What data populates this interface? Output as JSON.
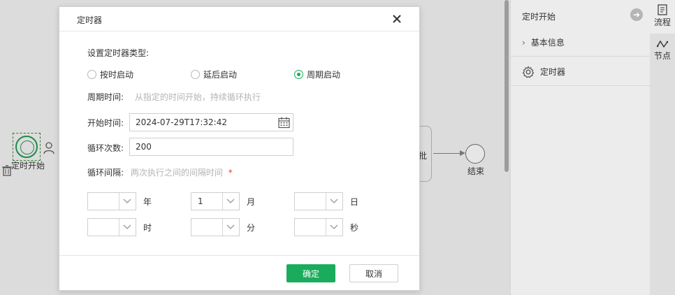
{
  "canvas": {
    "start_label": "定时开始",
    "task_text": "批",
    "end_label": "结束"
  },
  "panel": {
    "title": "定时开始",
    "rows": [
      {
        "label": "基本信息",
        "icon": "chevron-right-icon"
      },
      {
        "label": "定时器",
        "icon": "gear-icon"
      }
    ]
  },
  "side_tabs": [
    {
      "label": "流程",
      "icon": "flow-icon"
    },
    {
      "label": "节点",
      "icon": "node-icon"
    }
  ],
  "modal": {
    "title": "定时器",
    "type_label": "设置定时器类型:",
    "types": [
      {
        "label": "按时启动",
        "checked": false
      },
      {
        "label": "延后启动",
        "checked": false
      },
      {
        "label": "周期启动",
        "checked": true
      }
    ],
    "period_label": "周期时间:",
    "period_hint": "从指定的时间开始，持续循环执行",
    "start_time_label": "开始时间:",
    "start_time_value": "2024-07-29T17:32:42",
    "loop_count_label": "循环次数:",
    "loop_count_value": "200",
    "interval_label": "循环间隔:",
    "interval_hint": "两次执行之间的间隔时间",
    "required_mark": "*",
    "interval_fields": [
      {
        "value": "",
        "unit": "年"
      },
      {
        "value": "1",
        "unit": "月"
      },
      {
        "value": "",
        "unit": "日"
      },
      {
        "value": "",
        "unit": "时"
      },
      {
        "value": "",
        "unit": "分"
      },
      {
        "value": "",
        "unit": "秒"
      }
    ],
    "ok_label": "确定",
    "cancel_label": "取消"
  },
  "colors": {
    "accent": "#1aac5c",
    "required": "#e0403a",
    "hint": "#b4b4b4"
  }
}
